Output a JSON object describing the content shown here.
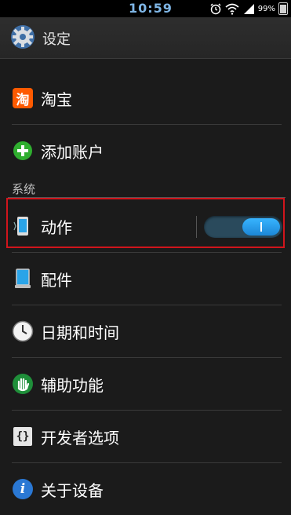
{
  "status_bar": {
    "time": "10:59",
    "battery_text": "99%",
    "icons": [
      "alarm-icon",
      "wifi-icon",
      "signal-icon",
      "battery-icon"
    ]
  },
  "action_bar": {
    "title": "设定",
    "icon": "settings-gear-icon"
  },
  "items": [
    {
      "label": "淘宝",
      "icon": "taobao-icon",
      "icon_text": "淘"
    },
    {
      "label": "添加账户",
      "icon": "add-account-icon"
    }
  ],
  "section": {
    "title": "系统",
    "items": [
      {
        "label": "动作",
        "icon": "motion-phone-icon",
        "toggle_on": true
      },
      {
        "label": "配件",
        "icon": "accessory-icon"
      },
      {
        "label": "日期和时间",
        "icon": "clock-icon"
      },
      {
        "label": "辅助功能",
        "icon": "accessibility-hand-icon"
      },
      {
        "label": "开发者选项",
        "icon": "developer-options-icon",
        "icon_text": "{}"
      },
      {
        "label": "关于设备",
        "icon": "info-icon",
        "icon_text": "i"
      }
    ]
  },
  "colors": {
    "background": "#1b1b1b",
    "accent": "#1c87d6",
    "highlight_border": "#d1151c"
  }
}
